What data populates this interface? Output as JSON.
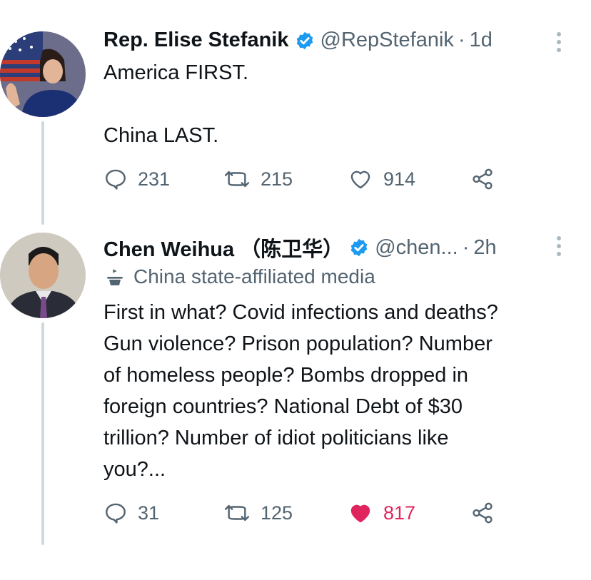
{
  "tweet1": {
    "name": "Rep. Elise Stefanik",
    "handle": "@RepStefanik",
    "separator": "·",
    "time": "1d",
    "text": "America FIRST.\n\nChina LAST.",
    "replies": "231",
    "retweets": "215",
    "likes": "914",
    "liked": false
  },
  "tweet2": {
    "name": "Chen Weihua （陈卫华）",
    "handle": "@chen...",
    "separator": "·",
    "time": "2h",
    "affiliation": "China state-affiliated media",
    "text": "First in what? Covid infections and deaths?\nGun violence? Prison population? Number\nof homeless people? Bombs dropped in\nforeign countries? National Debt of $30\ntrillion? Number of idiot politicians like\nyou?...",
    "replies": "31",
    "retweets": "125",
    "likes": "817",
    "liked": true
  },
  "colors": {
    "verified": "#1d9bf0",
    "muted": "#536471",
    "like_active": "#e0245e"
  },
  "icons": [
    "verified-badge-icon",
    "more-icon",
    "reply-icon",
    "retweet-icon",
    "like-icon",
    "share-icon",
    "media-affiliation-icon"
  ]
}
